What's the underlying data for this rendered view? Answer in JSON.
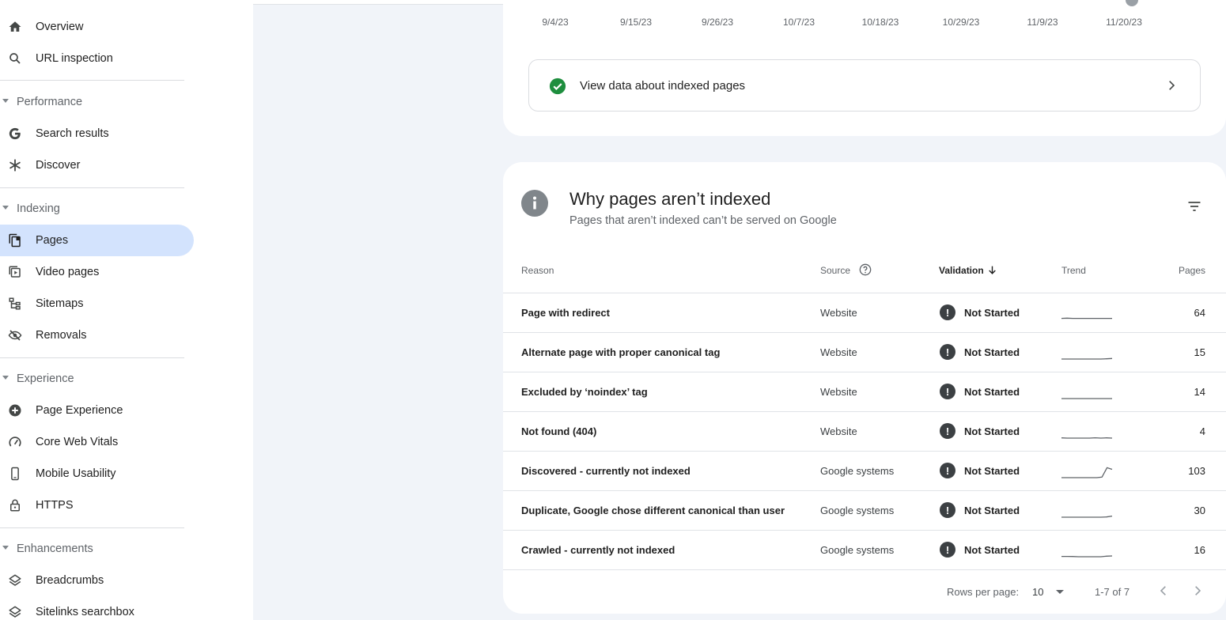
{
  "sidebar": {
    "items": [
      {
        "label": "Overview",
        "icon": "home-icon"
      },
      {
        "label": "URL inspection",
        "icon": "search-icon"
      },
      {
        "label": "Search results",
        "icon": "google-g-icon"
      },
      {
        "label": "Discover",
        "icon": "asterisk-icon"
      },
      {
        "label": "Pages",
        "icon": "pages-icon",
        "active": true
      },
      {
        "label": "Video pages",
        "icon": "video-pages-icon"
      },
      {
        "label": "Sitemaps",
        "icon": "sitemap-icon"
      },
      {
        "label": "Removals",
        "icon": "eye-off-icon"
      },
      {
        "label": "Page Experience",
        "icon": "plus-badge-icon"
      },
      {
        "label": "Core Web Vitals",
        "icon": "gauge-icon"
      },
      {
        "label": "Mobile Usability",
        "icon": "phone-icon"
      },
      {
        "label": "HTTPS",
        "icon": "lock-icon"
      },
      {
        "label": "Breadcrumbs",
        "icon": "layers-icon"
      },
      {
        "label": "Sitelinks searchbox",
        "icon": "layers-icon"
      }
    ],
    "sections": {
      "performance": "Performance",
      "indexing": "Indexing",
      "experience": "Experience",
      "enhancements": "Enhancements"
    }
  },
  "chart": {
    "x_ticks": [
      "9/4/23",
      "9/15/23",
      "9/26/23",
      "10/7/23",
      "10/18/23",
      "10/29/23",
      "11/9/23",
      "11/20/23"
    ]
  },
  "indexed_card": {
    "view_data_label": "View data about indexed pages"
  },
  "not_indexed": {
    "title": "Why pages aren’t indexed",
    "subtitle": "Pages that aren’t indexed can’t be served on Google",
    "columns": {
      "reason": "Reason",
      "source": "Source",
      "validation": "Validation",
      "trend": "Trend",
      "pages": "Pages"
    },
    "rows": [
      {
        "reason": "Page with redirect",
        "source": "Website",
        "validation": "Not Started",
        "pages": "64",
        "trend": [
          0.1,
          0.12,
          0.1,
          0.1,
          0.1,
          0.1,
          0.1,
          0.1,
          0.1,
          0.1
        ]
      },
      {
        "reason": "Alternate page with proper canonical tag",
        "source": "Website",
        "validation": "Not Started",
        "pages": "15",
        "trend": [
          0.0,
          0.0,
          0.0,
          0.0,
          0.0,
          0.0,
          0.0,
          0.0,
          0.02,
          0.05
        ]
      },
      {
        "reason": "Excluded by ‘noindex’ tag",
        "source": "Website",
        "validation": "Not Started",
        "pages": "14",
        "trend": [
          0.0,
          0.0,
          0.0,
          0.0,
          0.0,
          0.0,
          0.0,
          0.0,
          0.0,
          0.0
        ]
      },
      {
        "reason": "Not found (404)",
        "source": "Website",
        "validation": "Not Started",
        "pages": "4",
        "trend": [
          0.02,
          0.0,
          0.0,
          0.0,
          0.0,
          0.0,
          0.03,
          0.0,
          0.02,
          0.0
        ]
      },
      {
        "reason": "Discovered - currently not indexed",
        "source": "Google systems",
        "validation": "Not Started",
        "pages": "103",
        "trend": [
          0.0,
          0.0,
          0.0,
          0.0,
          0.0,
          0.0,
          0.0,
          0.0,
          0.05,
          0.9,
          0.75
        ]
      },
      {
        "reason": "Duplicate, Google chose different canonical than user",
        "source": "Google systems",
        "validation": "Not Started",
        "pages": "30",
        "trend": [
          0.0,
          0.0,
          0.0,
          0.0,
          0.0,
          0.0,
          0.0,
          0.0,
          0.02,
          0.1
        ]
      },
      {
        "reason": "Crawled - currently not indexed",
        "source": "Google systems",
        "validation": "Not Started",
        "pages": "16",
        "trend": [
          0.03,
          0.03,
          0.02,
          0.0,
          0.0,
          0.0,
          0.0,
          0.0,
          0.05,
          0.07
        ]
      }
    ],
    "footer": {
      "rows_per_page_label": "Rows per page:",
      "rows_per_page": "10",
      "range": "1-7 of 7"
    }
  },
  "colors": {
    "active_nav": "#d3e3fd",
    "success": "#1e8e3e",
    "page_bg": "#f1f4f9"
  }
}
